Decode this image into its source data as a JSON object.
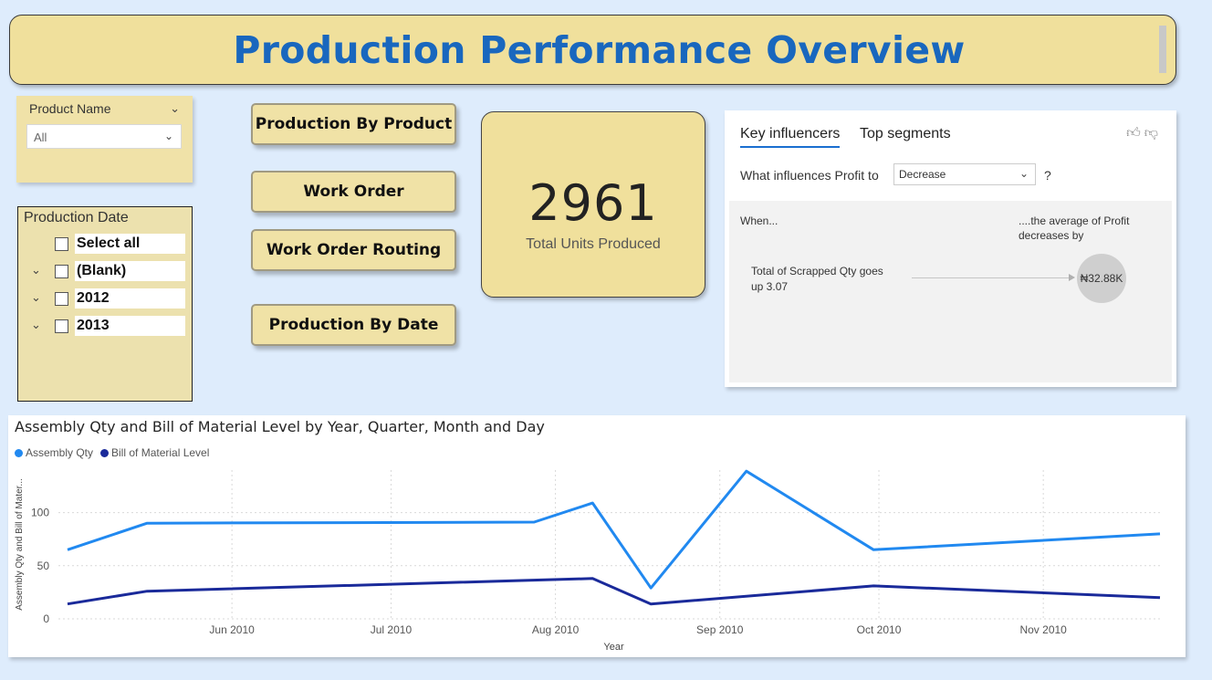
{
  "header": {
    "title": "Production Performance Overview"
  },
  "product_slicer": {
    "label": "Product Name",
    "value": "All"
  },
  "date_slicer": {
    "label": "Production Date",
    "items": [
      {
        "label": "Select all",
        "expandable": false
      },
      {
        "label": "(Blank)",
        "expandable": true
      },
      {
        "label": "2012",
        "expandable": true
      },
      {
        "label": "2013",
        "expandable": true
      }
    ]
  },
  "nav_buttons": [
    "Production By Product",
    "Work Order",
    "Work Order Routing",
    "Production By Date"
  ],
  "kpi": {
    "value": "2961",
    "label": "Total Units Produced"
  },
  "key_influencers": {
    "tab_active": "Key influencers",
    "tab_other": "Top segments",
    "question": "What influences Profit to",
    "selected": "Decrease",
    "question_mark": "?",
    "when_label": "When...",
    "avg_label": "....the average of Profit decreases by",
    "factor": "Total of Scrapped Qty goes up 3.07",
    "value": "₦32.88K"
  },
  "colors": {
    "accent": "#1967be",
    "series_1": "#2189f0",
    "series_2": "#1a2a9a"
  },
  "chart_data": {
    "type": "line",
    "title": "Assembly Qty and Bill of Material Level by Year, Quarter, Month and Day",
    "xlabel": "Year",
    "ylabel": "Assembly Qty and Bill of Mater...",
    "ylim": [
      0,
      140
    ],
    "yticks": [
      0,
      50,
      100
    ],
    "xtick_labels": [
      "Jun 2010",
      "Jul 2010",
      "Aug 2010",
      "Sep 2010",
      "Oct 2010",
      "Nov 2010"
    ],
    "xtick_dates": [
      "2010-06-01",
      "2010-07-01",
      "2010-08-01",
      "2010-09-01",
      "2010-10-01",
      "2010-11-01"
    ],
    "xlim": [
      "2010-05-01",
      "2010-11-23"
    ],
    "grid": true,
    "legend": "top-left",
    "series": [
      {
        "name": "Assembly Qty",
        "points": [
          [
            "2010-05-01",
            65
          ],
          [
            "2010-05-16",
            90
          ],
          [
            "2010-07-28",
            91
          ],
          [
            "2010-08-08",
            109
          ],
          [
            "2010-08-19",
            29
          ],
          [
            "2010-09-06",
            139
          ],
          [
            "2010-09-30",
            65
          ],
          [
            "2010-11-23",
            80
          ]
        ]
      },
      {
        "name": "Bill of Material Level",
        "points": [
          [
            "2010-05-01",
            14
          ],
          [
            "2010-05-16",
            26
          ],
          [
            "2010-08-08",
            38
          ],
          [
            "2010-08-19",
            14
          ],
          [
            "2010-09-30",
            31
          ],
          [
            "2010-11-23",
            20
          ]
        ]
      }
    ]
  }
}
